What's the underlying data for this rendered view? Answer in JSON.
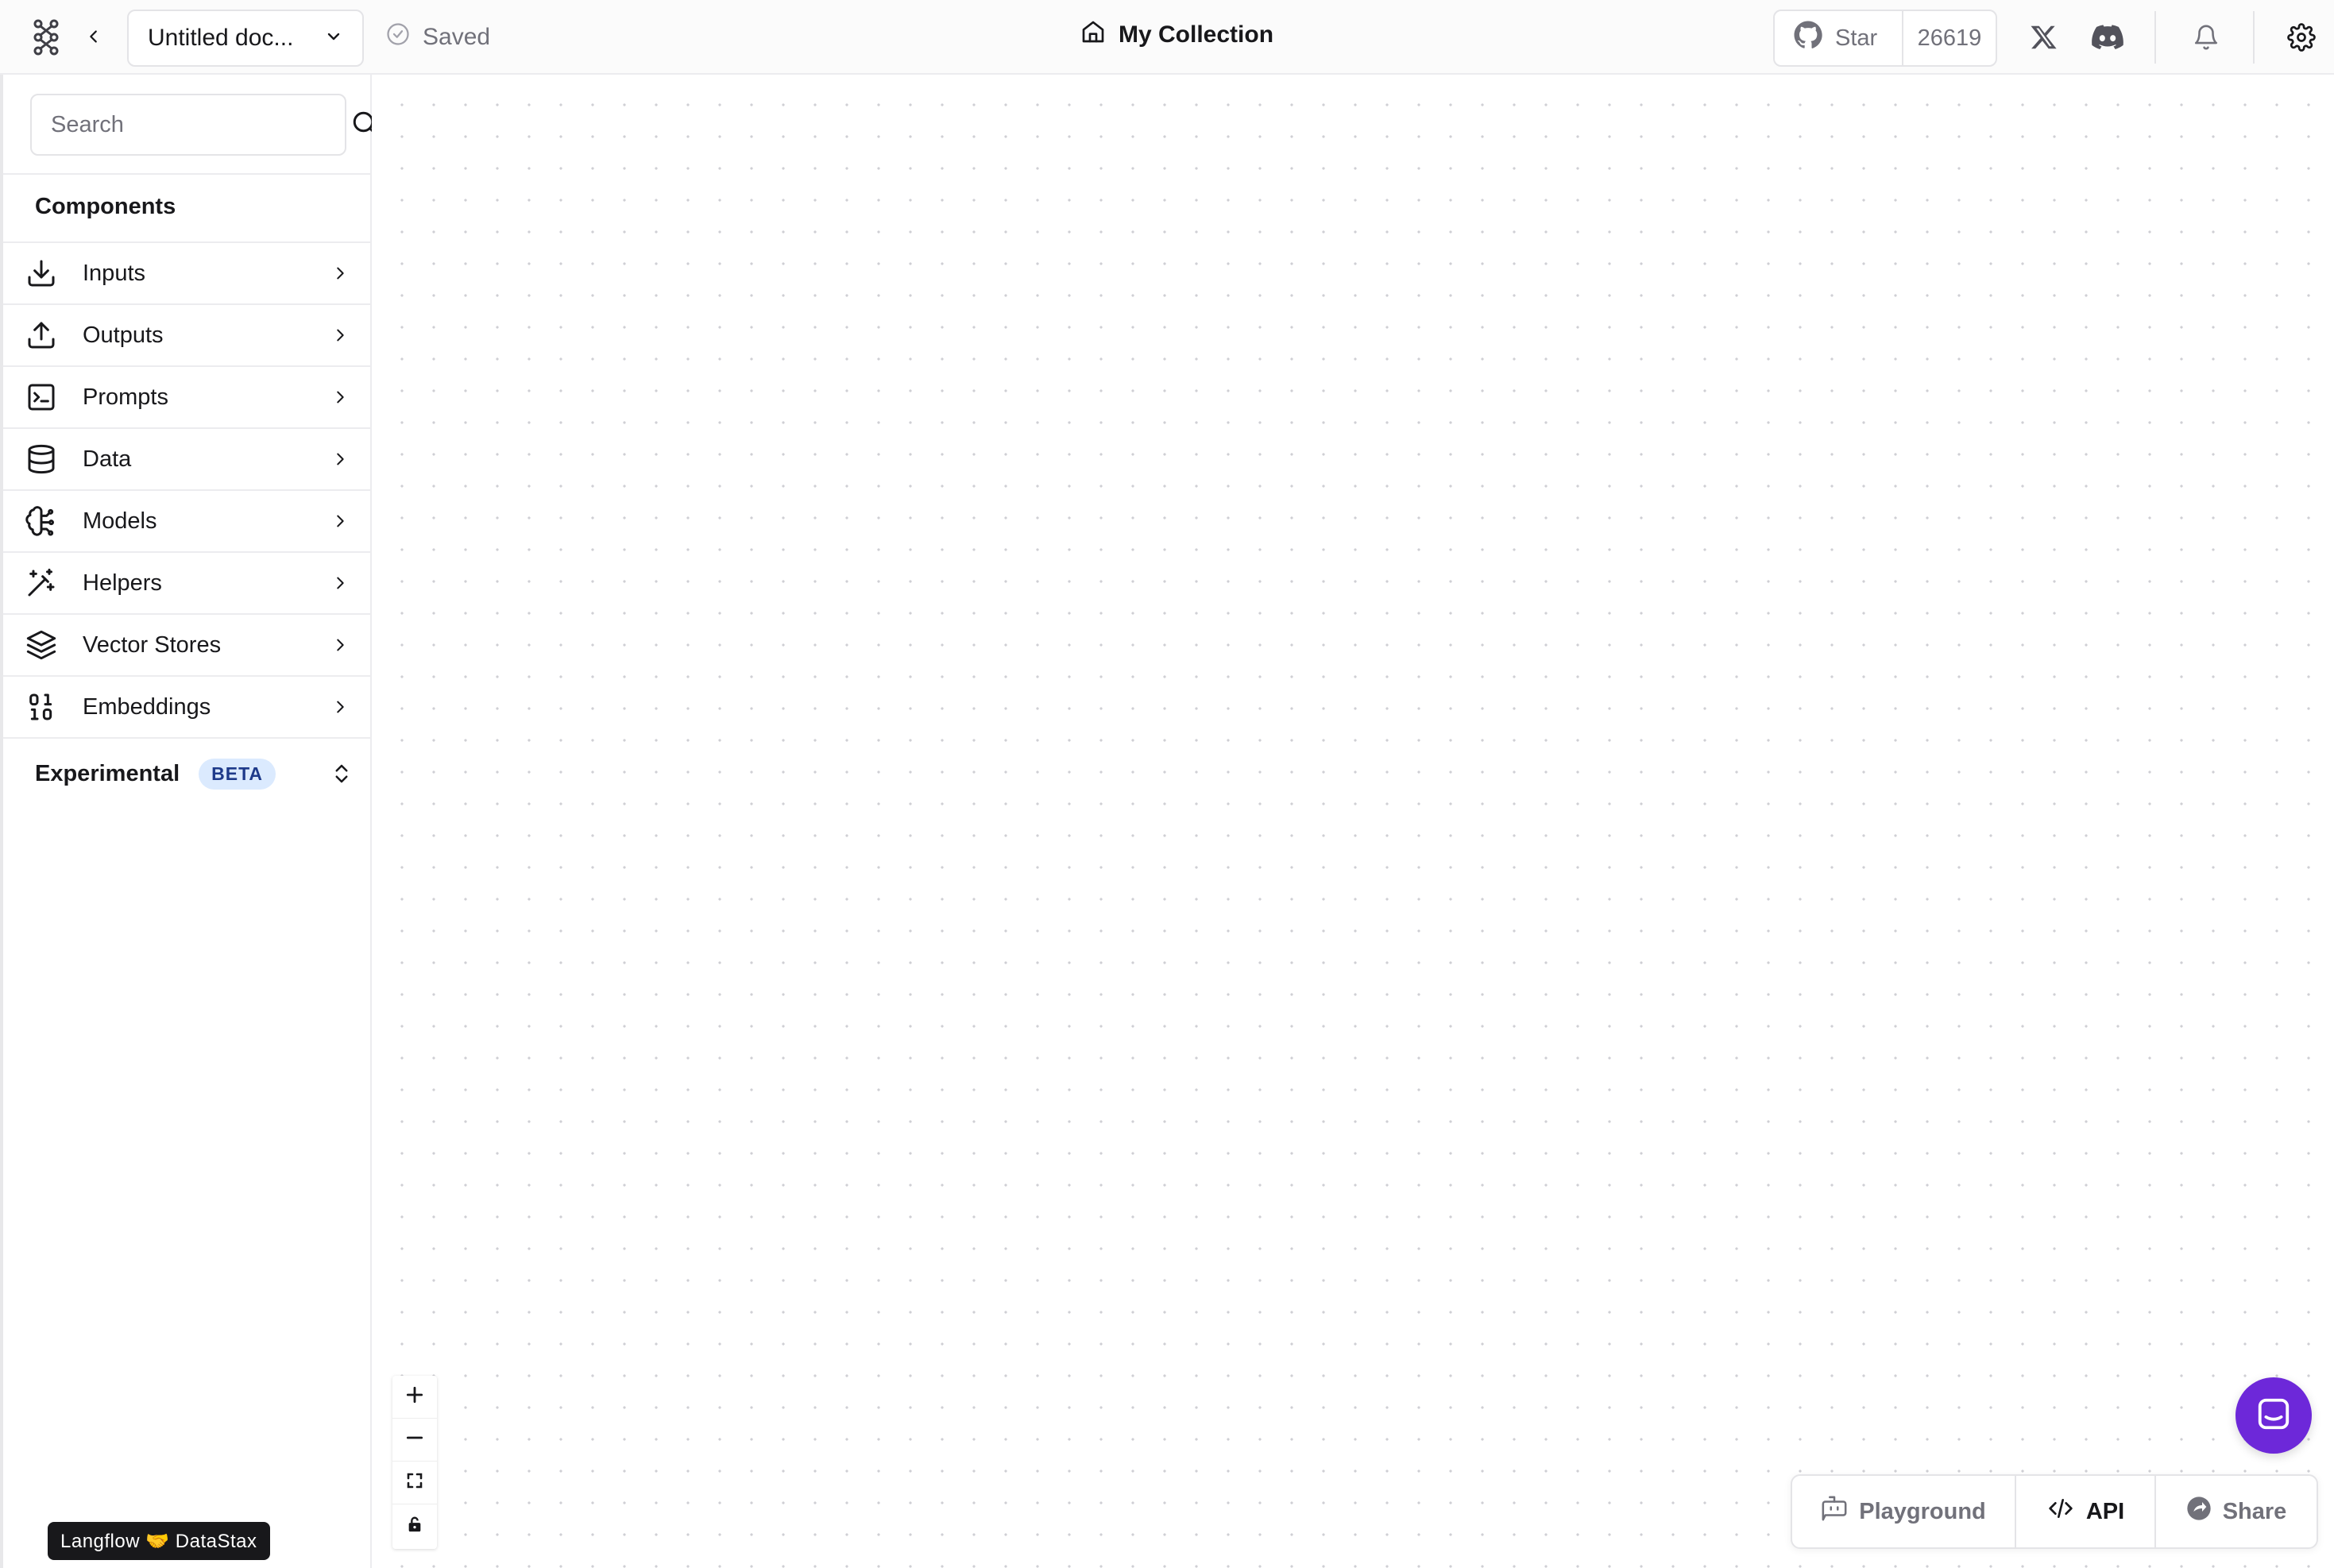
{
  "header": {
    "document_name": "Untitled doc...",
    "save_status": "Saved",
    "collection_label": "My Collection",
    "github": {
      "star_label": "Star",
      "star_count": "26619"
    }
  },
  "sidebar": {
    "search_placeholder": "Search",
    "components_title": "Components",
    "categories": [
      {
        "label": "Inputs",
        "icon": "download-icon"
      },
      {
        "label": "Outputs",
        "icon": "upload-icon"
      },
      {
        "label": "Prompts",
        "icon": "terminal-square-icon"
      },
      {
        "label": "Data",
        "icon": "database-icon"
      },
      {
        "label": "Models",
        "icon": "brain-circuit-icon"
      },
      {
        "label": "Helpers",
        "icon": "wand-sparkles-icon"
      },
      {
        "label": "Vector Stores",
        "icon": "layers-icon"
      },
      {
        "label": "Embeddings",
        "icon": "binary-icon"
      }
    ],
    "experimental_label": "Experimental",
    "experimental_badge": "BETA"
  },
  "footer_badge": "Langflow 🤝 DataStax",
  "bottom_bar": {
    "playground_label": "Playground",
    "api_label": "API",
    "share_label": "Share"
  },
  "colors": {
    "accent_purple": "#6d28d9",
    "beta_bg": "#dbeafe",
    "beta_text": "#1e3a8a",
    "canvas_dot": "#cfcfd4"
  }
}
